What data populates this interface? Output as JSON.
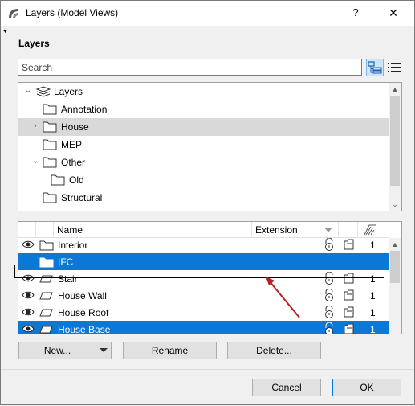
{
  "window": {
    "title": "Layers (Model Views)",
    "help_label": "?",
    "close_label": "✕"
  },
  "section_label": "Layers",
  "search": {
    "placeholder": "Search"
  },
  "view_toggle": {
    "tree_icon": "folder-tree-icon",
    "list_icon": "list-view-icon",
    "active": "tree"
  },
  "tree": {
    "items": [
      {
        "label": "Layers",
        "icon": "layers-stack-icon",
        "expanded": true,
        "depth": 0
      },
      {
        "label": "Annotation",
        "icon": "folder-icon",
        "depth": 1
      },
      {
        "label": "House",
        "icon": "folder-icon",
        "collapsed": true,
        "selected": true,
        "depth": 1
      },
      {
        "label": "MEP",
        "icon": "folder-icon",
        "depth": 1
      },
      {
        "label": "Other",
        "icon": "folder-icon",
        "expanded": true,
        "depth": 1
      },
      {
        "label": "Old",
        "icon": "folder-icon",
        "depth": 2
      },
      {
        "label": "Structural",
        "icon": "folder-icon",
        "depth": 1
      }
    ]
  },
  "list": {
    "columns": {
      "name": "Name",
      "extension": "Extension"
    },
    "rows": [
      {
        "name": "Interior",
        "type": "folder",
        "visible": true,
        "count": "1",
        "selected": false
      },
      {
        "name": "IFC",
        "type": "folder",
        "visible": false,
        "count": "",
        "selected": true
      },
      {
        "name": "Stair",
        "type": "layer",
        "visible": true,
        "count": "1",
        "selected": false
      },
      {
        "name": "House Wall",
        "type": "layer",
        "visible": true,
        "count": "1",
        "selected": false
      },
      {
        "name": "House Roof",
        "type": "layer",
        "visible": true,
        "count": "1",
        "selected": false
      },
      {
        "name": "House Base",
        "type": "layer",
        "visible": true,
        "count": "1",
        "selected": true
      }
    ]
  },
  "buttons": {
    "new": "New...",
    "rename": "Rename",
    "delete": "Delete...",
    "cancel": "Cancel",
    "ok": "OK"
  },
  "colors": {
    "selection": "#0a78d7",
    "tree_selection": "#d9d9d9",
    "annotation_arrow": "#b22222"
  }
}
